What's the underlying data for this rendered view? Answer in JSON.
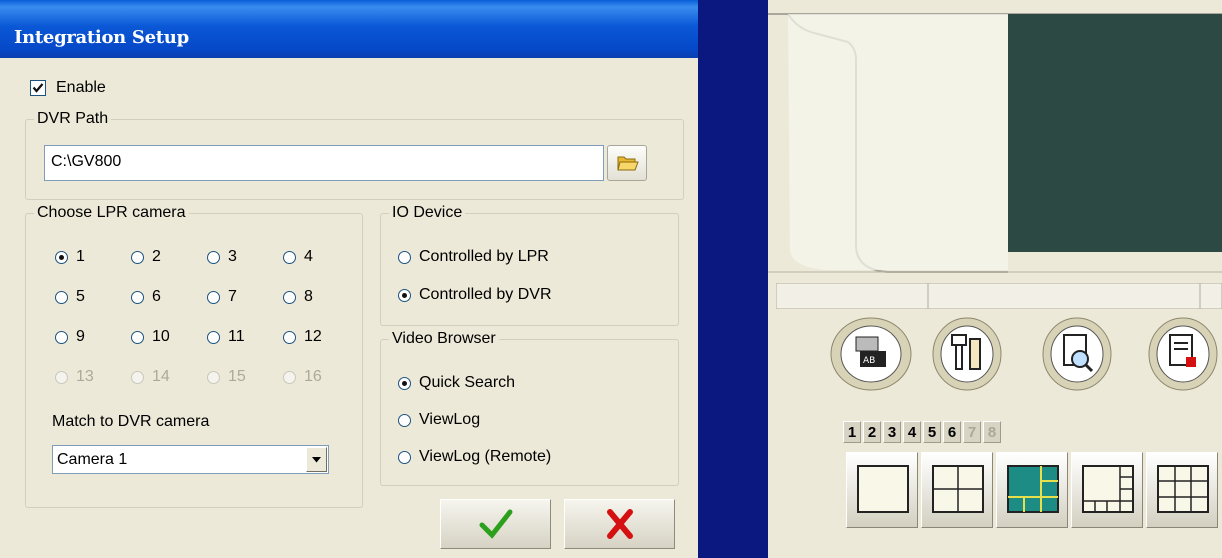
{
  "dialog": {
    "title": "Integration Setup",
    "enable_label": "Enable",
    "enable_checked": true,
    "dvr_path": {
      "legend": "DVR Path",
      "value": "C:\\GV800",
      "browse_icon": "folder-open-icon"
    },
    "lpr_camera": {
      "legend": "Choose LPR camera",
      "options": [
        "1",
        "2",
        "3",
        "4",
        "5",
        "6",
        "7",
        "8",
        "9",
        "10",
        "11",
        "12",
        "13",
        "14",
        "15",
        "16"
      ],
      "selected": "1",
      "disabled": [
        "13",
        "14",
        "15",
        "16"
      ],
      "match_label": "Match to DVR camera",
      "match_value": "Camera 1"
    },
    "io_device": {
      "legend": "IO Device",
      "options": [
        "Controlled by LPR",
        "Controlled by DVR"
      ],
      "selected": "Controlled by DVR"
    },
    "video_browser": {
      "legend": "Video Browser",
      "options": [
        "Quick Search",
        "ViewLog",
        "ViewLog (Remote)"
      ],
      "selected": "Quick Search"
    },
    "ok_icon": "checkmark-icon",
    "cancel_icon": "x-mark-icon"
  },
  "right_panel": {
    "tool_icons": [
      "camera-config-icon",
      "tools-icon",
      "search-document-icon",
      "log-document-icon"
    ],
    "digits": [
      "1",
      "2",
      "3",
      "4",
      "5",
      "6",
      "7",
      "8"
    ],
    "disabled_digits": [
      "7",
      "8"
    ],
    "layouts": [
      "layout-1-icon",
      "layout-4-icon",
      "layout-6-icon",
      "layout-8-icon",
      "layout-9-icon"
    ]
  },
  "colors": {
    "titlebar": "#0548c8",
    "dialog_bg": "#ece9d8",
    "divider": "#0a1880",
    "video_screen": "#2c4a43",
    "ok_green": "#2ca01c",
    "cancel_red": "#d41010"
  }
}
